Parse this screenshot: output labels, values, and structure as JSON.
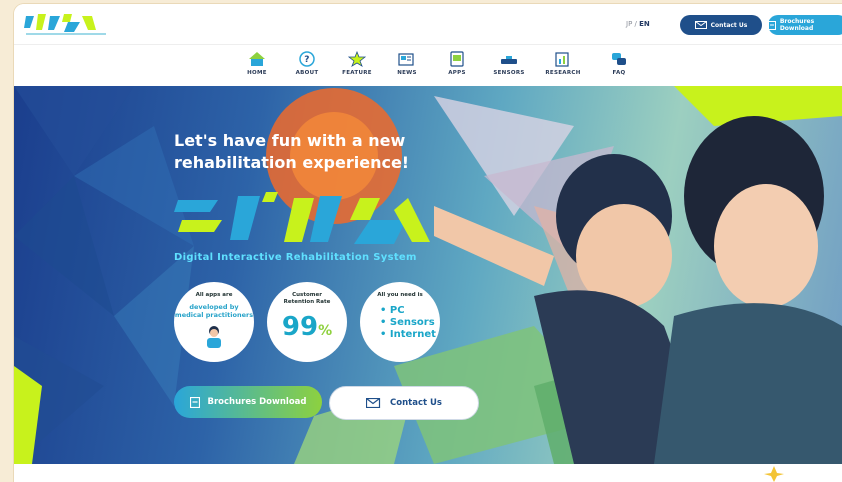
{
  "header": {
    "lang_jp": "JP",
    "lang_sep": " / ",
    "lang_en": "EN",
    "contact_label": "Contact Us",
    "brochure_label": "Brochures Download"
  },
  "nav": {
    "items": [
      {
        "label": "HOME",
        "icon": "home-icon"
      },
      {
        "label": "ABOUT",
        "icon": "question-icon"
      },
      {
        "label": "FEATURE",
        "icon": "star-icon"
      },
      {
        "label": "NEWS",
        "icon": "news-icon"
      },
      {
        "label": "APPS",
        "icon": "apps-icon"
      },
      {
        "label": "SENSORS",
        "icon": "sensor-icon"
      },
      {
        "label": "RESEARCH",
        "icon": "research-icon"
      },
      {
        "label": "FAQ",
        "icon": "faq-icon"
      }
    ]
  },
  "hero": {
    "title_line1": "Let's have fun with a new",
    "title_line2": "rehabilitation experience!",
    "subtitle": "Digital Interactive Rehabilitation System",
    "badge1": {
      "line1": "All apps are",
      "line2": "developed by",
      "line3": "medical practitioners"
    },
    "badge2": {
      "line1": "Customer",
      "line2": "Retention Rate",
      "value": "99",
      "unit": "%"
    },
    "badge3": {
      "line1": "All you need is",
      "items": [
        "• PC",
        "• Sensors",
        "• Internet"
      ]
    },
    "cta_brochure": "Brochures Download",
    "cta_contact": "Contact Us"
  },
  "colors": {
    "brand_dark": "#1f4f8a",
    "brand_cyan": "#2aa6d9",
    "brand_lime": "#c8f21c"
  }
}
